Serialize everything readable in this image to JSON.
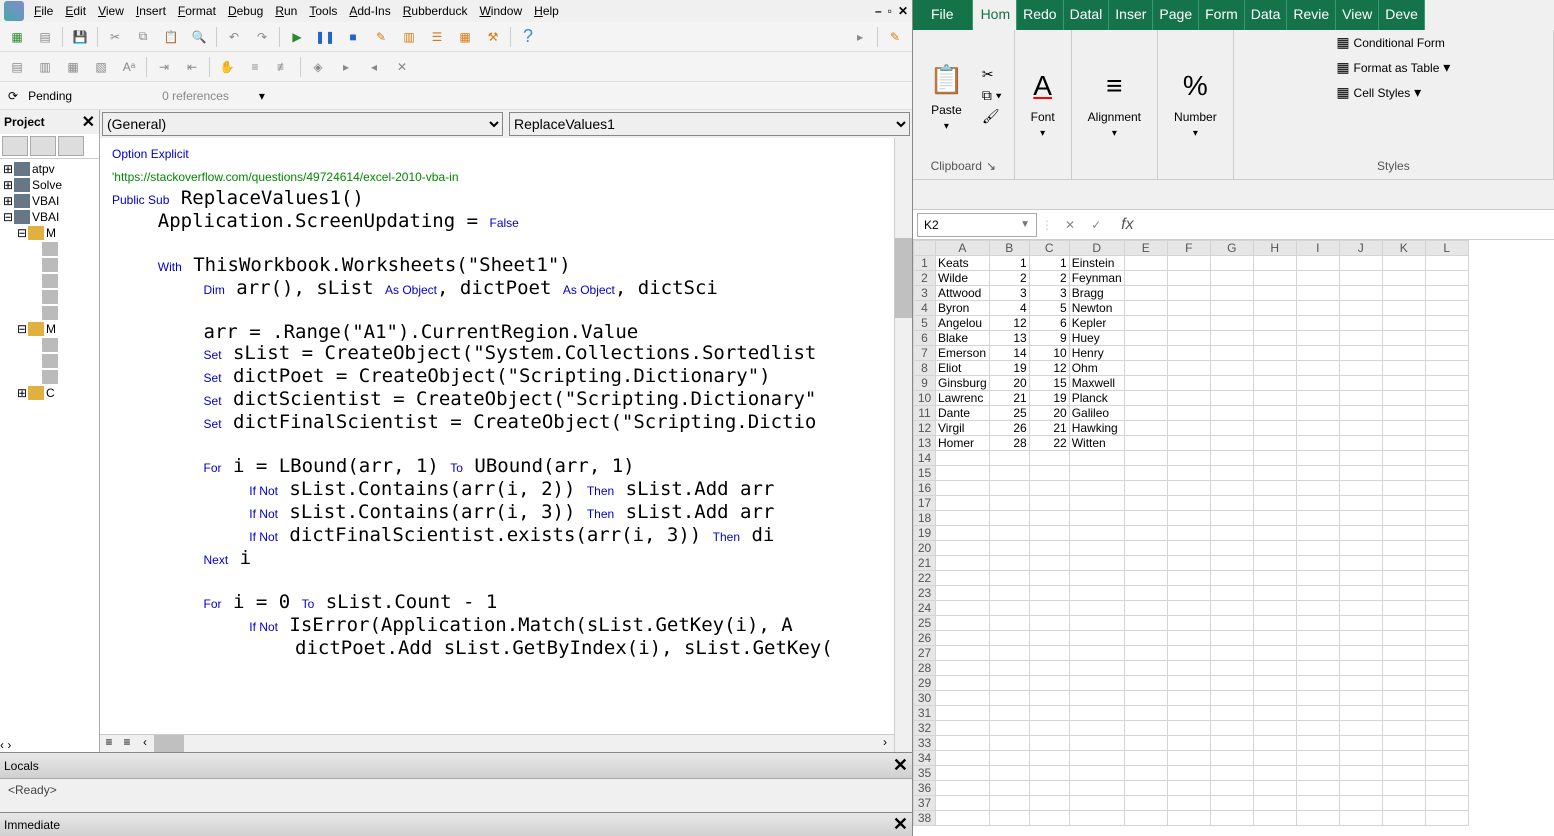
{
  "vba": {
    "menus": [
      "File",
      "Edit",
      "View",
      "Insert",
      "Format",
      "Debug",
      "Run",
      "Tools",
      "Add-Ins",
      "Rubberduck",
      "Window",
      "Help"
    ],
    "pending_label": "Pending",
    "references_label": "0 references",
    "project_panel_title": "Project",
    "tree": [
      {
        "level": 0,
        "exp": "⊞",
        "icon": "proj",
        "label": "atpv"
      },
      {
        "level": 0,
        "exp": "⊞",
        "icon": "proj",
        "label": "Solve"
      },
      {
        "level": 0,
        "exp": "⊞",
        "icon": "proj",
        "label": "VBAI"
      },
      {
        "level": 0,
        "exp": "⊟",
        "icon": "proj",
        "label": "VBAI"
      },
      {
        "level": 1,
        "exp": "⊟",
        "icon": "folder",
        "label": "M"
      },
      {
        "level": 2,
        "exp": "",
        "icon": "mod",
        "label": ""
      },
      {
        "level": 2,
        "exp": "",
        "icon": "mod",
        "label": ""
      },
      {
        "level": 2,
        "exp": "",
        "icon": "mod",
        "label": ""
      },
      {
        "level": 2,
        "exp": "",
        "icon": "mod",
        "label": ""
      },
      {
        "level": 2,
        "exp": "",
        "icon": "mod",
        "label": ""
      },
      {
        "level": 1,
        "exp": "⊟",
        "icon": "folder",
        "label": "M"
      },
      {
        "level": 2,
        "exp": "",
        "icon": "mod",
        "label": ""
      },
      {
        "level": 2,
        "exp": "",
        "icon": "mod",
        "label": ""
      },
      {
        "level": 2,
        "exp": "",
        "icon": "mod",
        "label": ""
      },
      {
        "level": 1,
        "exp": "⊞",
        "icon": "folder",
        "label": "C"
      }
    ],
    "combo_left": "(General)",
    "combo_right": "ReplaceValues1",
    "code_html": "<span class='kw'>Option Explicit</span>\n<span class='cm'>'https://stackoverflow.com/questions/49724614/excel-2010-vba-in</span>\n<span class='kw'>Public Sub</span> ReplaceValues1()\n    Application.ScreenUpdating = <span class='kw'>False</span>\n\n    <span class='kw'>With</span> ThisWorkbook.Worksheets(\"Sheet1\")\n        <span class='kw'>Dim</span> arr(), sList <span class='kw'>As Object</span>, dictPoet <span class='kw'>As Object</span>, dictSci\n\n        arr = .Range(\"A1\").CurrentRegion.Value\n        <span class='kw'>Set</span> sList = CreateObject(\"System.Collections.Sortedlist\n        <span class='kw'>Set</span> dictPoet = CreateObject(\"Scripting.Dictionary\")\n        <span class='kw'>Set</span> dictScientist = CreateObject(\"Scripting.Dictionary\"\n        <span class='kw'>Set</span> dictFinalScientist = CreateObject(\"Scripting.Dictio\n\n        <span class='kw'>For</span> i = LBound(arr, 1) <span class='kw'>To</span> UBound(arr, 1)\n            <span class='kw'>If Not</span> sList.Contains(arr(i, 2)) <span class='kw'>Then</span> sList.Add arr\n            <span class='kw'>If Not</span> sList.Contains(arr(i, 3)) <span class='kw'>Then</span> sList.Add arr\n            <span class='kw'>If Not</span> dictFinalScientist.exists(arr(i, 3)) <span class='kw'>Then</span> di\n        <span class='kw'>Next</span> i\n\n        <span class='kw'>For</span> i = 0 <span class='kw'>To</span> sList.Count - 1\n            <span class='kw'>If Not</span> IsError(Application.Match(sList.GetKey(i), A\n                dictPoet.Add sList.GetByIndex(i), sList.GetKey(",
    "locals_title": "Locals",
    "locals_ready": "<Ready>",
    "immediate_title": "Immediate"
  },
  "excel": {
    "tabs": [
      "File",
      "Hom",
      "Redo",
      "Datal",
      "Inser",
      "Page",
      "Form",
      "Data",
      "Revie",
      "View",
      "Deve"
    ],
    "active_tab": 1,
    "ribbon": {
      "clipboard_label": "Clipboard",
      "paste_label": "Paste",
      "font_label": "Font",
      "alignment_label": "Alignment",
      "number_label": "Number",
      "styles_label": "Styles",
      "cond_fmt": "Conditional Form",
      "as_table": "Format as Table",
      "cell_styles": "Cell Styles"
    },
    "name_box": "K2",
    "fx_label": "fx",
    "columns": [
      "A",
      "B",
      "C",
      "D",
      "E",
      "F",
      "G",
      "H",
      "I",
      "J",
      "K",
      "L"
    ],
    "rows": [
      {
        "r": 1,
        "A": "Keats",
        "B": 1,
        "C": 1,
        "D": "Einstein"
      },
      {
        "r": 2,
        "A": "Wilde",
        "B": 2,
        "C": 2,
        "D": "Feynman"
      },
      {
        "r": 3,
        "A": "Attwood",
        "B": 3,
        "C": 3,
        "D": "Bragg"
      },
      {
        "r": 4,
        "A": "Byron",
        "B": 4,
        "C": 5,
        "D": "Newton"
      },
      {
        "r": 5,
        "A": "Angelou",
        "B": 12,
        "C": 6,
        "D": "Kepler"
      },
      {
        "r": 6,
        "A": "Blake",
        "B": 13,
        "C": 9,
        "D": "Huey"
      },
      {
        "r": 7,
        "A": "Emerson",
        "B": 14,
        "C": 10,
        "D": "Henry"
      },
      {
        "r": 8,
        "A": "Eliot",
        "B": 19,
        "C": 12,
        "D": "Ohm"
      },
      {
        "r": 9,
        "A": "Ginsburg",
        "B": 20,
        "C": 15,
        "D": "Maxwell"
      },
      {
        "r": 10,
        "A": "Lawrenc",
        "B": 21,
        "C": 19,
        "D": "Planck"
      },
      {
        "r": 11,
        "A": "Dante",
        "B": 25,
        "C": 20,
        "D": "Galileo"
      },
      {
        "r": 12,
        "A": "Virgil",
        "B": 26,
        "C": 21,
        "D": "Hawking"
      },
      {
        "r": 13,
        "A": "Homer",
        "B": 28,
        "C": 22,
        "D": "Witten"
      }
    ],
    "total_rows": 38
  }
}
